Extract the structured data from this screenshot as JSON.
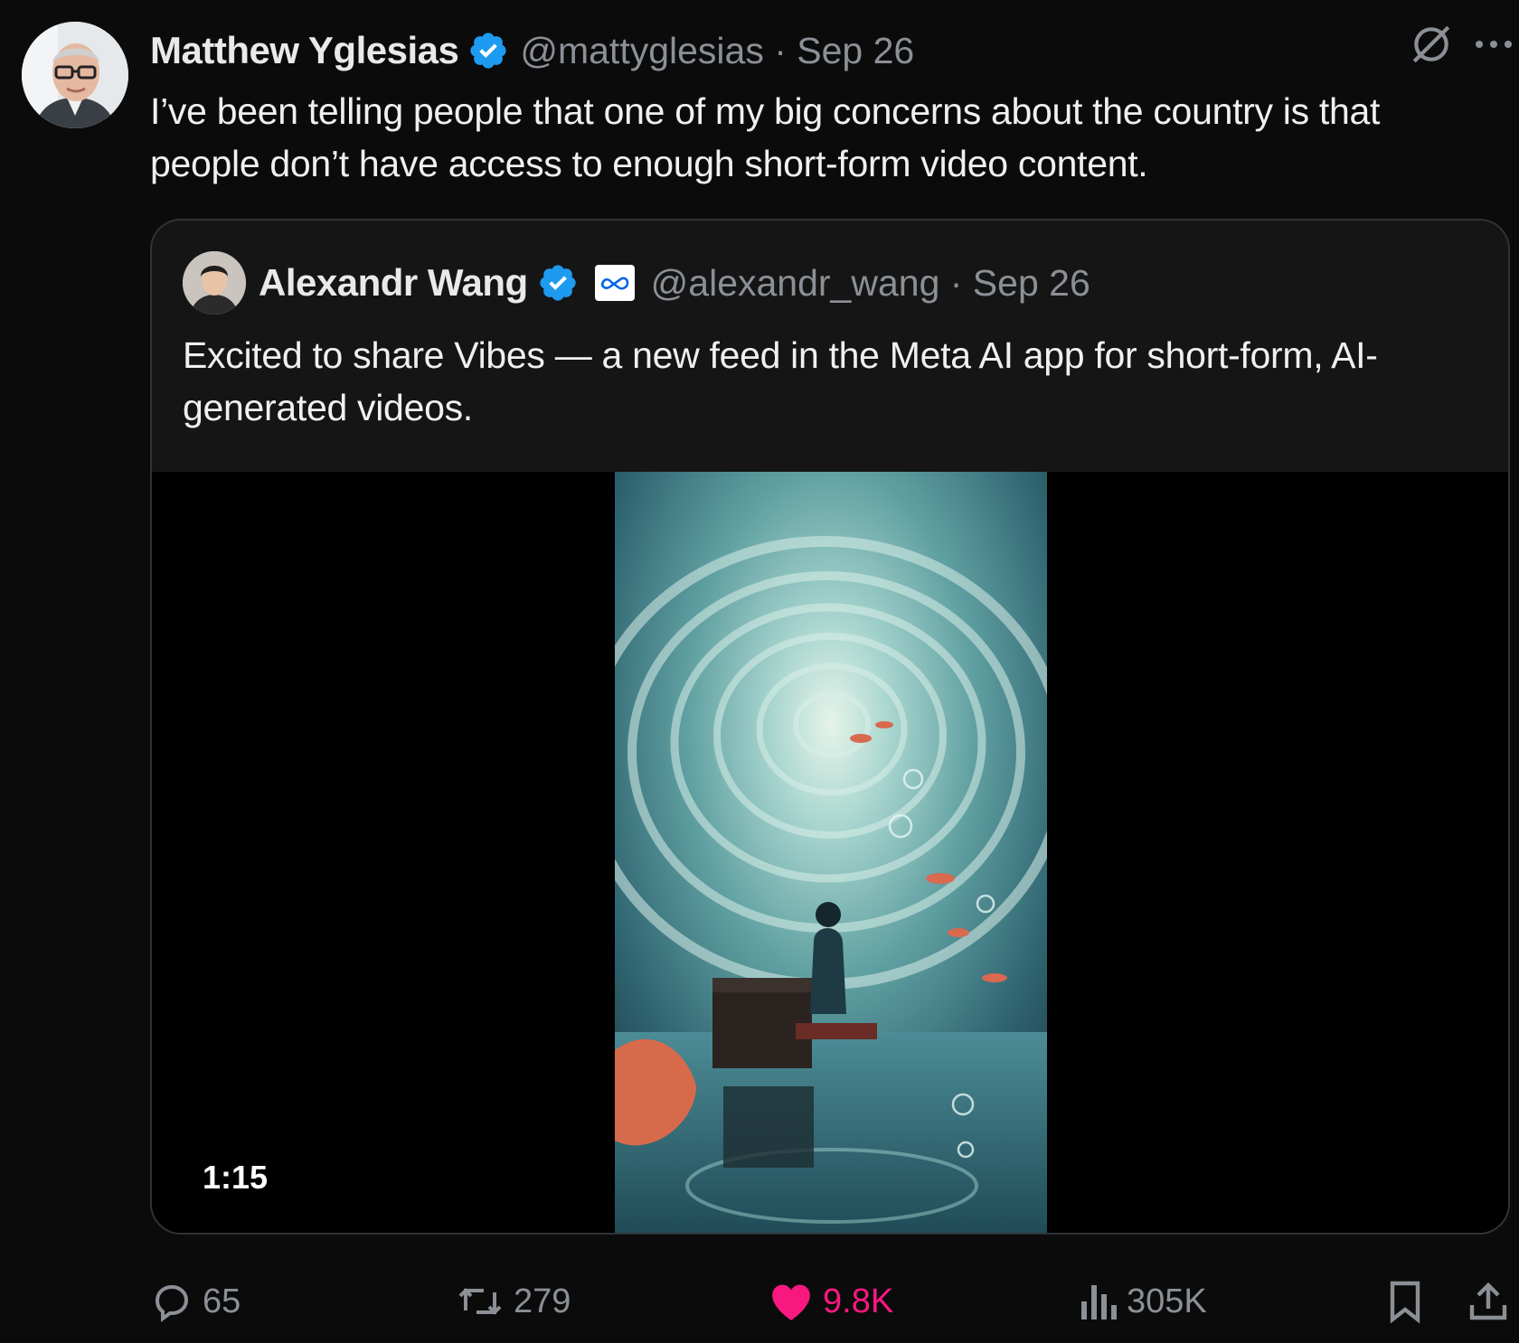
{
  "tweet": {
    "author_name": "Matthew Yglesias",
    "handle": "@mattyglesias",
    "date": "Sep 26",
    "handle_date": "@mattyglesias · Sep 26",
    "text": "I’ve been telling people that one of my big concerns about the country is that people don’t have access to enough short-form video content."
  },
  "quoted_tweet": {
    "author_name": "Alexandr Wang",
    "handle_date": "@alexandr_wang · Sep 26",
    "text": "Excited to share Vibes — a new feed in the Meta AI app for short-form, AI-generated videos.",
    "video_duration": "1:15"
  },
  "actions": {
    "replies": "65",
    "reposts": "279",
    "likes": "9.8K",
    "views": "305K"
  },
  "icons": {
    "verified": "verified-badge-icon",
    "grok": "grok-icon",
    "more": "more-icon",
    "reply": "reply-icon",
    "repost": "repost-icon",
    "like": "heart-icon",
    "views": "views-icon",
    "bookmark": "bookmark-icon",
    "share": "share-icon",
    "affiliate": "meta-affiliate-icon"
  },
  "colors": {
    "background": "#0b0b0b",
    "verified_blue": "#1d9bf0",
    "like_pink": "#f91880",
    "muted_text": "#8b9096"
  }
}
